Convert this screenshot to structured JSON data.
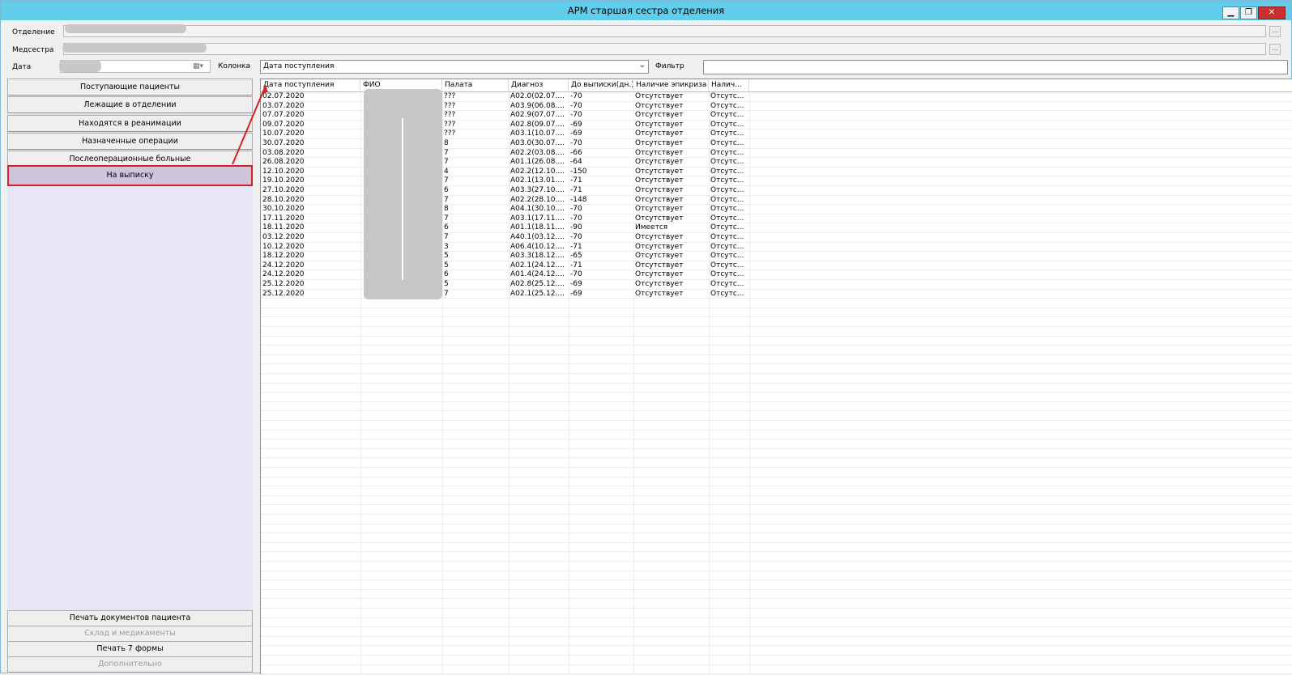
{
  "window": {
    "title": "АРМ старшая сестра отделения",
    "min_glyph": "▁",
    "max_glyph": "❐",
    "close_glyph": "✕"
  },
  "form": {
    "department_label": "Отделение",
    "nurse_label": "Медсестра",
    "date_label": "Дата",
    "column_label": "Колонка",
    "column_value": "Дата поступления",
    "filter_label": "Фильтр",
    "filter_value": "",
    "ellipsis": "..."
  },
  "nav": {
    "incoming": "Поступающие пациенты",
    "lying": "Лежащие в отделении",
    "icu": "Находятся в реанимации",
    "operations": "Назначенные операции",
    "postop": "Послеоперационные больные",
    "discharge": "На выписку",
    "print_docs": "Печать документов пациента",
    "warehouse": "Склад и медикаменты",
    "print_form7": "Печать 7 формы",
    "extra": "Дополнительно"
  },
  "grid": {
    "columns": [
      "Дата поступления",
      "ФИО",
      "Палата",
      "Диагноз",
      "До выписки(дн.)",
      "Наличие эпикриза",
      "Налич..."
    ],
    "rows": [
      [
        "02.07.2020",
        "",
        "???",
        "A02.0(02.07....",
        "-70",
        "Отсутствует",
        "Отсутс..."
      ],
      [
        "03.07.2020",
        "",
        "???",
        "A03.9(06.08....",
        "-70",
        "Отсутствует",
        "Отсутс..."
      ],
      [
        "07.07.2020",
        "",
        "???",
        "A02.9(07.07....",
        "-70",
        "Отсутствует",
        "Отсутс..."
      ],
      [
        "09.07.2020",
        "",
        "???",
        "A02.8(09.07....",
        "-69",
        "Отсутствует",
        "Отсутс..."
      ],
      [
        "10.07.2020",
        "",
        "???",
        "A03.1(10.07....",
        "-69",
        "Отсутствует",
        "Отсутс..."
      ],
      [
        "30.07.2020",
        "",
        "8",
        "A03.0(30.07....",
        "-70",
        "Отсутствует",
        "Отсутс..."
      ],
      [
        "03.08.2020",
        "",
        "7",
        "A02.2(03.08....",
        "-66",
        "Отсутствует",
        "Отсутс..."
      ],
      [
        "26.08.2020",
        "",
        "7",
        "A01.1(26.08....",
        "-64",
        "Отсутствует",
        "Отсутс..."
      ],
      [
        "12.10.2020",
        "",
        "4",
        "A02.2(12.10....",
        "-150",
        "Отсутствует",
        "Отсутс..."
      ],
      [
        "19.10.2020",
        "",
        "7",
        "A02.1(13.01....",
        "-71",
        "Отсутствует",
        "Отсутс..."
      ],
      [
        "27.10.2020",
        "",
        "6",
        "A03.3(27.10....",
        "-71",
        "Отсутствует",
        "Отсутс..."
      ],
      [
        "28.10.2020",
        "",
        "7",
        "A02.2(28.10....",
        "-148",
        "Отсутствует",
        "Отсутс..."
      ],
      [
        "30.10.2020",
        "",
        "8",
        "A04.1(30.10....",
        "-70",
        "Отсутствует",
        "Отсутс..."
      ],
      [
        "17.11.2020",
        "",
        "7",
        "A03.1(17.11....",
        "-70",
        "Отсутствует",
        "Отсутс..."
      ],
      [
        "18.11.2020",
        "",
        "6",
        "A01.1(18.11....",
        "-90",
        "Имеется",
        "Отсутс..."
      ],
      [
        "03.12.2020",
        "",
        "7",
        "A40.1(03.12....",
        "-70",
        "Отсутствует",
        "Отсутс..."
      ],
      [
        "10.12.2020",
        "",
        "3",
        "A06.4(10.12....",
        "-71",
        "Отсутствует",
        "Отсутс..."
      ],
      [
        "18.12.2020",
        "",
        "5",
        "A03.3(18.12....",
        "-65",
        "Отсутствует",
        "Отсутс..."
      ],
      [
        "24.12.2020",
        "",
        "5",
        "A02.1(24.12....",
        "-71",
        "Отсутствует",
        "Отсутс..."
      ],
      [
        "24.12.2020",
        "",
        "6",
        "A01.4(24.12....",
        "-70",
        "Отсутствует",
        "Отсутс..."
      ],
      [
        "25.12.2020",
        "",
        "5",
        "A02.8(25.12....",
        "-69",
        "Отсутствует",
        "Отсутс..."
      ],
      [
        "25.12.2020",
        "",
        "7",
        "A02.1(25.12....",
        "-69",
        "Отсутствует",
        "Отсутс..."
      ]
    ]
  },
  "colors": {
    "titlebar": "#62cdea",
    "left_panel": "#e6e6f7",
    "selected_button": "#cfc4de",
    "annotation": "#d92020"
  }
}
